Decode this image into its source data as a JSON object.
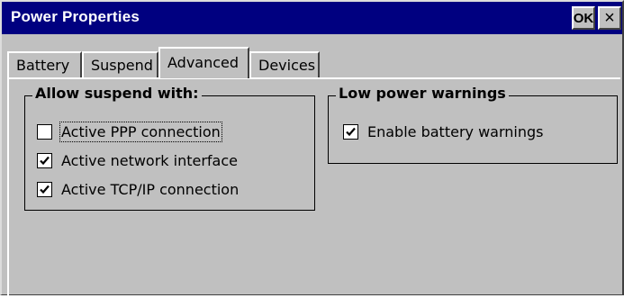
{
  "window": {
    "title": "Power Properties",
    "ok_label": "OK",
    "close_label": "×"
  },
  "tabs": [
    {
      "label": "Battery",
      "active": false
    },
    {
      "label": "Suspend",
      "active": false
    },
    {
      "label": "Advanced",
      "active": true
    },
    {
      "label": "Devices",
      "active": false
    }
  ],
  "allow_suspend": {
    "title": "Allow suspend with:",
    "items": [
      {
        "label": "Active PPP connection",
        "checked": false,
        "focused": true
      },
      {
        "label": "Active network interface",
        "checked": true,
        "focused": false
      },
      {
        "label": "Active TCP/IP connection",
        "checked": true,
        "focused": false
      }
    ]
  },
  "low_power": {
    "title": "Low power warnings",
    "items": [
      {
        "label": "Enable battery warnings",
        "checked": true
      }
    ]
  },
  "colors": {
    "titlebar": "#000080",
    "face": "#c0c0c0"
  },
  "icons": {
    "check": "checkmark-icon",
    "close": "close-icon"
  }
}
